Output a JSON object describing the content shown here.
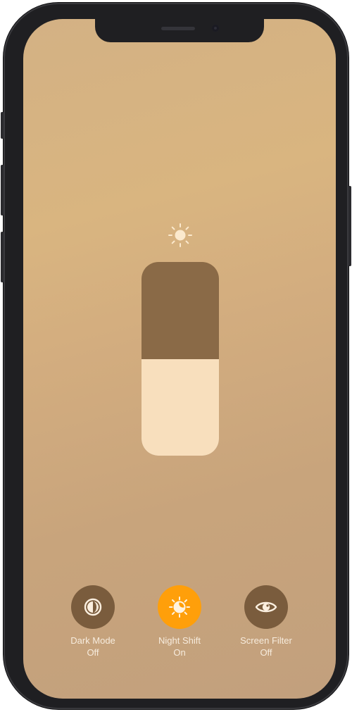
{
  "colors": {
    "slider_track": "#8a6a47",
    "slider_fill": "#f8dfbd",
    "button_off": "#7a5c3d",
    "button_on": "#ff9f0a",
    "label_text": "#f7ecdd"
  },
  "brightness": {
    "icon": "sun-icon",
    "level_percent": 50
  },
  "controls": [
    {
      "icon": "dark-mode-icon",
      "title": "Dark Mode",
      "state": "Off",
      "active": false
    },
    {
      "icon": "night-shift-icon",
      "title": "Night Shift",
      "state": "On",
      "active": true
    },
    {
      "icon": "eye-icon",
      "title": "Screen Filter",
      "state": "Off",
      "active": false
    }
  ]
}
